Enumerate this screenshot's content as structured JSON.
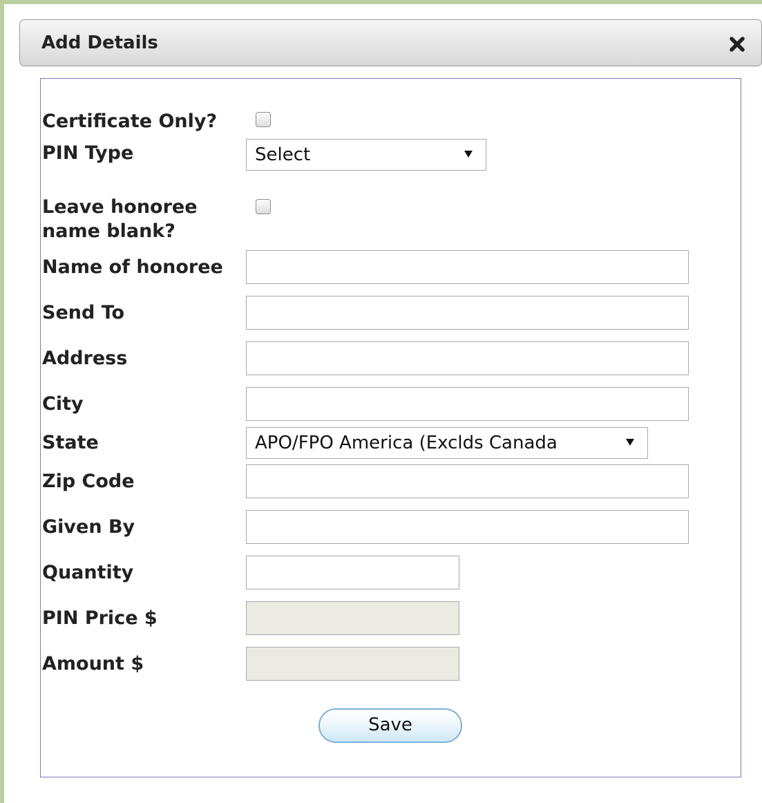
{
  "dialog": {
    "title": "Add Details",
    "close_icon": "close-icon"
  },
  "form": {
    "certificate_only": {
      "label": "Certificate Only?",
      "checked": false
    },
    "pin_type": {
      "label": "PIN Type",
      "selected": "Select"
    },
    "leave_blank": {
      "label_line1": "Leave honoree",
      "label_line2": "name blank?",
      "checked": false
    },
    "honoree_name": {
      "label": "Name of honoree",
      "value": ""
    },
    "send_to": {
      "label": "Send To",
      "value": ""
    },
    "address": {
      "label": "Address",
      "value": ""
    },
    "city": {
      "label": "City",
      "value": ""
    },
    "state": {
      "label": "State",
      "selected": "APO/FPO America (Exclds Canada"
    },
    "zip_code": {
      "label": "Zip Code",
      "value": ""
    },
    "given_by": {
      "label": "Given By",
      "value": ""
    },
    "quantity": {
      "label": "Quantity",
      "value": ""
    },
    "pin_price": {
      "label": "PIN Price $",
      "value": ""
    },
    "amount": {
      "label": "Amount $",
      "value": ""
    },
    "save_label": "Save"
  },
  "colors": {
    "frame_border": "#b9cf9f",
    "form_border": "#7f78b8",
    "disabled_field": "#ebebe4",
    "button_border": "#7fb0d6"
  }
}
